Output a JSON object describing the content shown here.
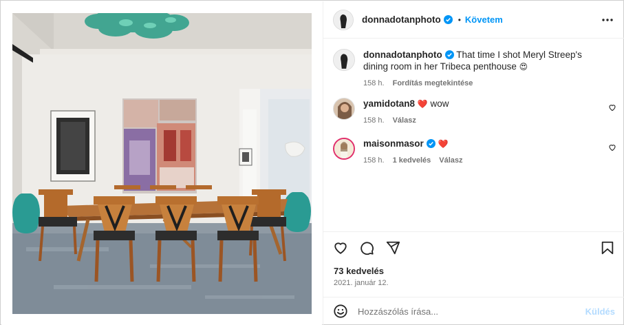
{
  "post": {
    "author": "donnadotanphoto",
    "follow_label": "Követem",
    "separator": "•",
    "caption_author": "donnadotanphoto",
    "caption_text": "That time I shot Meryl Streep's dining room in her Tribeca penthouse",
    "caption_emoji": "😍",
    "caption_time": "158 h.",
    "translate_label": "Fordítás megtekintése"
  },
  "comments": [
    {
      "user": "yamidotan8",
      "emoji": "❤️",
      "text": "wow",
      "time": "158 h.",
      "reply_label": "Válasz"
    },
    {
      "user": "maisonmasor",
      "emoji": "❤️",
      "text": "",
      "time": "158 h.",
      "likes_label": "1 kedvelés",
      "reply_label": "Válasz"
    }
  ],
  "stats": {
    "likes": "73 kedvelés",
    "date": "2021. január 12."
  },
  "composer": {
    "placeholder": "Hozzászólás írása...",
    "send_label": "Küldés"
  },
  "colors": {
    "accent": "#0095f6",
    "verified": "#0095f6",
    "heart": "#ed4956",
    "muted": "#737373"
  },
  "icons": [
    "more-icon",
    "heart-icon",
    "comment-icon",
    "share-icon",
    "bookmark-icon",
    "emoji-icon",
    "verified-icon"
  ]
}
